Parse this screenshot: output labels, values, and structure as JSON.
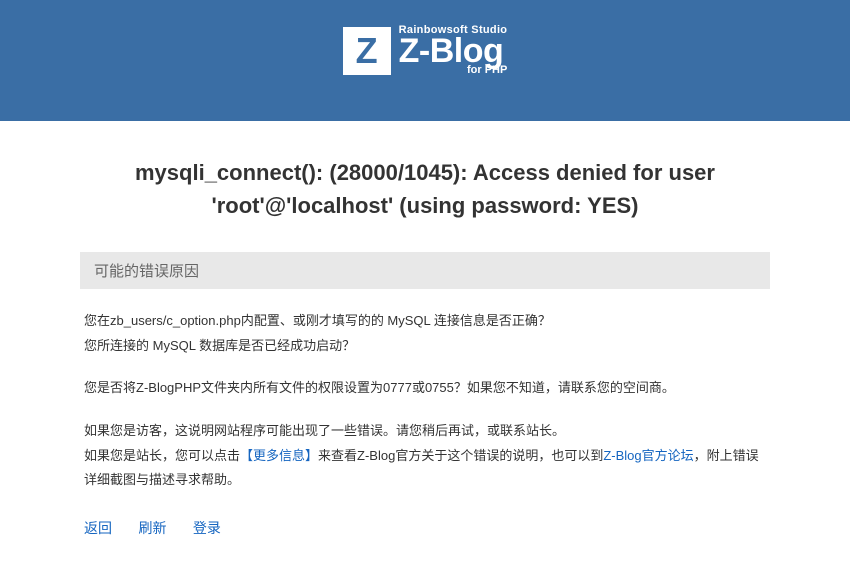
{
  "logo": {
    "letter": "Z",
    "top": "Rainbowsoft Studio",
    "main": "Z-Blog",
    "sub": "for PHP"
  },
  "error": {
    "title": "mysqli_connect(): (28000/1045): Access denied for user 'root'@'localhost' (using password: YES)",
    "section_header": "可能的错误原因",
    "para1_line1": "您在zb_users/c_option.php内配置、或刚才填写的的 MySQL 连接信息是否正确？",
    "para1_line2": "您所连接的 MySQL 数据库是否已经成功启动？",
    "para2": "您是否将Z-BlogPHP文件夹内所有文件的权限设置为0777或0755？如果您不知道，请联系您的空间商。",
    "para3_pre": "如果您是访客，这说明网站程序可能出现了一些错误。请您稍后再试，或联系站长。",
    "para3_line2_a": "如果您是站长，您可以点击",
    "para3_link1": "【更多信息】",
    "para3_line2_b": "来查看Z-Blog官方关于这个错误的说明，也可以到",
    "para3_link2": "Z-Blog官方论坛",
    "para3_line2_c": "，附上错误详细截图与描述寻求帮助。"
  },
  "actions": {
    "back": "返回",
    "refresh": "刷新",
    "login": "登录"
  }
}
